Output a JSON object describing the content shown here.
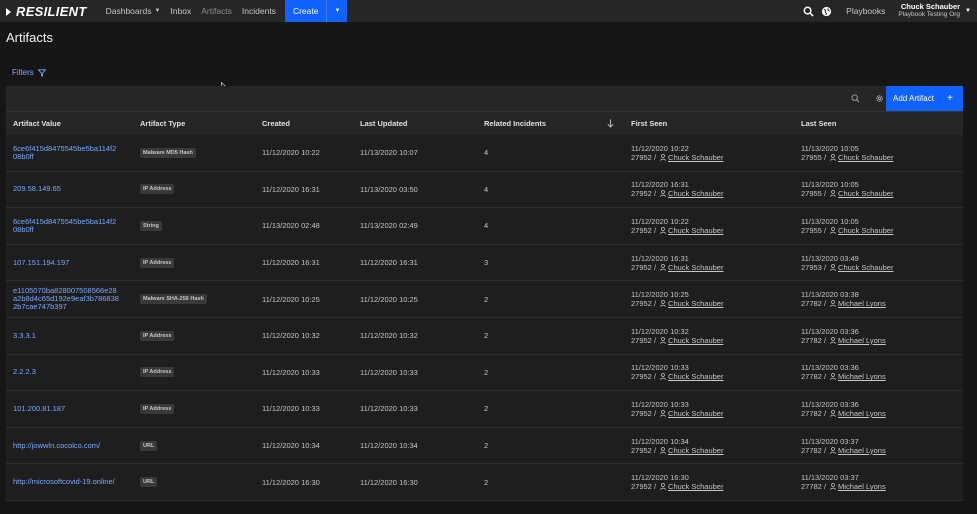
{
  "nav": {
    "logo": "RESILIENT",
    "dashboards": "Dashboards",
    "inbox": "Inbox",
    "artifacts": "Artifacts",
    "incidents": "Incidents",
    "create": "Create",
    "playbooks": "Playbooks",
    "user_name": "Chuck Schauber",
    "user_org": "Playbook Testing Org"
  },
  "page": {
    "title": "Artifacts",
    "filters": "Filters"
  },
  "toolbar": {
    "add_artifact": "Add Artifact",
    "add_plus": "+"
  },
  "table": {
    "headers": {
      "value": "Artifact Value",
      "type": "Artifact Type",
      "created": "Created",
      "updated": "Last Updated",
      "related": "Related Incidents",
      "first_seen": "First Seen",
      "last_seen": "Last Seen"
    },
    "rows": [
      {
        "value_l1": "6ce6f415d8475545be5ba114f2",
        "value_l2": "08b0ff",
        "value_l3": "",
        "type": "Malware MD5 Hash",
        "created": "11/12/2020 10:22",
        "updated": "11/13/2020 10:07",
        "related": "4",
        "first_date": "11/12/2020 10:22",
        "first_id": "27952",
        "first_user": "Chuck Schauber",
        "last_date": "11/13/2020 10:05",
        "last_id": "27955",
        "last_user": "Chuck Schauber"
      },
      {
        "value_l1": "209.58.149.65",
        "value_l2": "",
        "value_l3": "",
        "type": "IP Address",
        "created": "11/12/2020 16:31",
        "updated": "11/13/2020 03:50",
        "related": "4",
        "first_date": "11/12/2020 16:31",
        "first_id": "27952",
        "first_user": "Chuck Schauber",
        "last_date": "11/13/2020 10:05",
        "last_id": "27955",
        "last_user": "Chuck Schauber"
      },
      {
        "value_l1": "6ce6f415d8475545be5ba114f2",
        "value_l2": "08b0ff",
        "value_l3": "",
        "type": "String",
        "created": "11/13/2020 02:48",
        "updated": "11/13/2020 02:49",
        "related": "4",
        "first_date": "11/12/2020 10:22",
        "first_id": "27952",
        "first_user": "Chuck Schauber",
        "last_date": "11/13/2020 10:05",
        "last_id": "27955",
        "last_user": "Chuck Schauber"
      },
      {
        "value_l1": "107.151.194.197",
        "value_l2": "",
        "value_l3": "",
        "type": "IP Address",
        "created": "11/12/2020 16:31",
        "updated": "11/12/2020 16:31",
        "related": "3",
        "first_date": "11/12/2020 16:31",
        "first_id": "27952",
        "first_user": "Chuck Schauber",
        "last_date": "11/13/2020 03:49",
        "last_id": "27953",
        "last_user": "Chuck Schauber"
      },
      {
        "value_l1": "e1105070ba828007508566e28",
        "value_l2": "a2b8d4c65d192e9eaf3b786838",
        "value_l3": "2b7cae747b397",
        "type": "Malware SHA-256 Hash",
        "created": "11/12/2020 10:25",
        "updated": "11/12/2020 10:25",
        "related": "2",
        "first_date": "11/12/2020 10:25",
        "first_id": "27952",
        "first_user": "Chuck Schauber",
        "last_date": "11/13/2020 03:38",
        "last_id": "27782",
        "last_user": "Michael Lyons"
      },
      {
        "value_l1": "3.3.3.1",
        "value_l2": "",
        "value_l3": "",
        "type": "IP Address",
        "created": "11/12/2020 10:32",
        "updated": "11/12/2020 10:32",
        "related": "2",
        "first_date": "11/12/2020 10:32",
        "first_id": "27952",
        "first_user": "Chuck Schauber",
        "last_date": "11/13/2020 03:36",
        "last_id": "27782",
        "last_user": "Michael Lyons"
      },
      {
        "value_l1": "2.2.2.3",
        "value_l2": "",
        "value_l3": "",
        "type": "IP Address",
        "created": "11/12/2020 10:33",
        "updated": "11/12/2020 10:33",
        "related": "2",
        "first_date": "11/12/2020 10:33",
        "first_id": "27952",
        "first_user": "Chuck Schauber",
        "last_date": "11/13/2020 03:36",
        "last_id": "27782",
        "last_user": "Michael Lyons"
      },
      {
        "value_l1": "101.200.81.187",
        "value_l2": "",
        "value_l3": "",
        "type": "IP Address",
        "created": "11/12/2020 10:33",
        "updated": "11/12/2020 10:33",
        "related": "2",
        "first_date": "11/12/2020 10:33",
        "first_id": "27952",
        "first_user": "Chuck Schauber",
        "last_date": "11/13/2020 03:36",
        "last_id": "27782",
        "last_user": "Michael Lyons"
      },
      {
        "value_l1": "http://jowwln.cocolco.com/",
        "value_l2": "",
        "value_l3": "",
        "type": "URL",
        "created": "11/12/2020 10:34",
        "updated": "11/12/2020 10:34",
        "related": "2",
        "first_date": "11/12/2020 10:34",
        "first_id": "27952",
        "first_user": "Chuck Schauber",
        "last_date": "11/13/2020 03:37",
        "last_id": "27782",
        "last_user": "Michael Lyons"
      },
      {
        "value_l1": "http://microsoftcovid-19.online/",
        "value_l2": "",
        "value_l3": "",
        "type": "URL",
        "created": "11/12/2020 16:30",
        "updated": "11/12/2020 16:30",
        "related": "2",
        "first_date": "11/12/2020 16:30",
        "first_id": "27952",
        "first_user": "Chuck Schauber",
        "last_date": "11/13/2020 03:37",
        "last_id": "27782",
        "last_user": "Michael Lyons"
      }
    ]
  },
  "colors": {
    "accent": "#0f62fe",
    "link": "#78a9ff",
    "background": "#161616"
  },
  "icons": [
    "search-icon",
    "globe-icon",
    "filter-icon",
    "gear-icon",
    "user-icon",
    "sort-arrow-icon",
    "chevron-down-icon"
  ]
}
